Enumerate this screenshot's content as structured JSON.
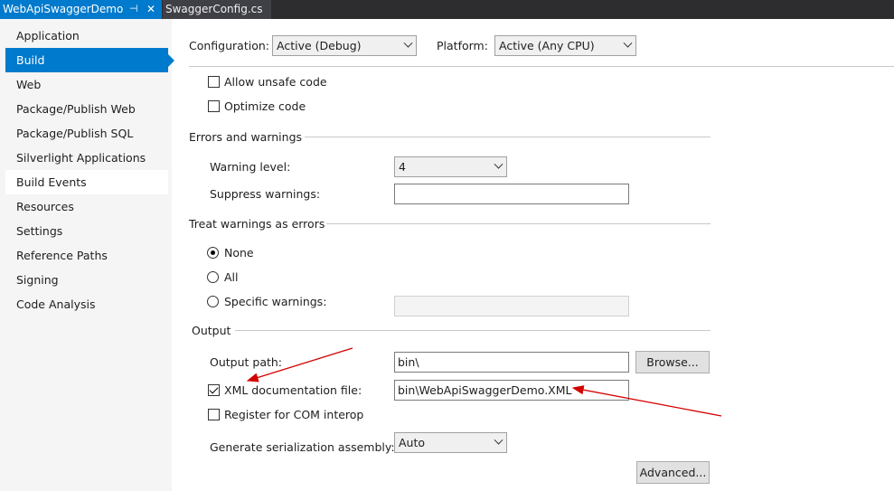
{
  "tabs": {
    "active": {
      "label": "WebApiSwaggerDemo",
      "pin": "⊣",
      "close": "✕"
    },
    "second": {
      "label": "SwaggerConfig.cs"
    }
  },
  "sidebar": {
    "items": [
      {
        "label": "Application"
      },
      {
        "label": "Build"
      },
      {
        "label": "Web"
      },
      {
        "label": "Package/Publish Web"
      },
      {
        "label": "Package/Publish SQL"
      },
      {
        "label": "Silverlight Applications"
      },
      {
        "label": "Build Events"
      },
      {
        "label": "Resources"
      },
      {
        "label": "Settings"
      },
      {
        "label": "Reference Paths"
      },
      {
        "label": "Signing"
      },
      {
        "label": "Code Analysis"
      }
    ],
    "selected": "Build"
  },
  "config": {
    "configuration_label": "Configuration:",
    "configuration_value": "Active (Debug)",
    "platform_label": "Platform:",
    "platform_value": "Active (Any CPU)"
  },
  "general": {
    "allow_unsafe_label": "Allow unsafe code",
    "allow_unsafe_checked": false,
    "optimize_label": "Optimize code",
    "optimize_checked": false
  },
  "errors": {
    "section_title": "Errors and warnings",
    "warning_level_label": "Warning level:",
    "warning_level_value": "4",
    "suppress_label": "Suppress warnings:",
    "suppress_value": ""
  },
  "treat": {
    "section_title": "Treat warnings as errors",
    "none_label": "None",
    "all_label": "All",
    "specific_label": "Specific warnings:",
    "selected": "None",
    "specific_value": ""
  },
  "output": {
    "section_title": "Output",
    "output_path_label": "Output path:",
    "output_path_value": "bin\\",
    "browse_label": "Browse...",
    "xml_doc_label": "XML documentation file:",
    "xml_doc_checked": true,
    "xml_doc_value": "bin\\WebApiSwaggerDemo.XML",
    "com_interop_label": "Register for COM interop",
    "com_interop_checked": false,
    "serialization_label": "Generate serialization assembly:",
    "serialization_value": "Auto",
    "advanced_label": "Advanced..."
  },
  "colors": {
    "accent": "#007acc",
    "annotation_arrow": "#d40000"
  }
}
